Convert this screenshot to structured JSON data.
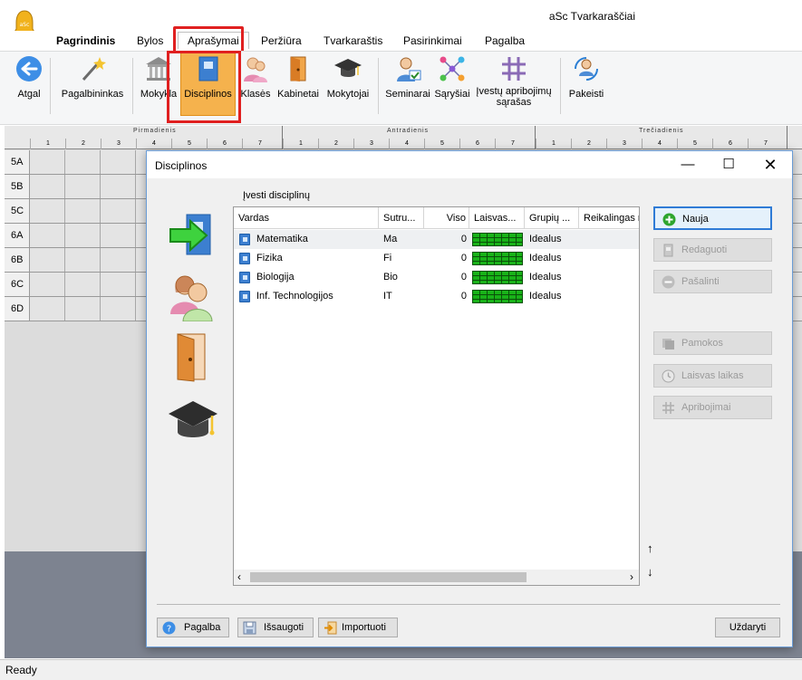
{
  "app": {
    "title": "aSc Tvarkaraščiai",
    "logo_text": "aSc"
  },
  "menu": {
    "tabs": [
      "Pagrindinis",
      "Bylos",
      "Aprašymai",
      "Peržiūra",
      "Tvarkaraštis",
      "Pasirinkimai",
      "Pagalba"
    ],
    "active": "Aprašymai"
  },
  "ribbon": {
    "atgal": "Atgal",
    "pagalbininkas": "Pagalbininkas",
    "mokykla": "Mokykla",
    "disciplinos": "Disciplinos",
    "klases": "Klasės",
    "kabinetai": "Kabinetai",
    "mokytojai": "Mokytojai",
    "seminarai": "Seminarai",
    "sarysiai": "Sąryšiai",
    "apribojimai_line1": "Įvestų apribojimų",
    "apribojimai_line2": "sąrašas",
    "pakeisti": "Pakeisti"
  },
  "grid": {
    "days": [
      "Pirmadienis",
      "Antradienis",
      "Trečiadienis"
    ],
    "periods": [
      "1",
      "2",
      "3",
      "4",
      "5",
      "6",
      "7"
    ],
    "rows": [
      "5A",
      "5B",
      "5C",
      "6A",
      "6B",
      "6C",
      "6D"
    ]
  },
  "status": {
    "text": "Ready"
  },
  "dialog": {
    "title": "Disciplinos",
    "list_caption": "Įvesti disciplinų",
    "columns": [
      "Vardas",
      "Sutru...",
      "Viso",
      "Laisvas...",
      "Grupių ...",
      "Reikalingas r"
    ],
    "rows": [
      {
        "name": "Matematika",
        "short": "Ma",
        "total": "0",
        "groups": "Idealus"
      },
      {
        "name": "Fizika",
        "short": "Fi",
        "total": "0",
        "groups": "Idealus"
      },
      {
        "name": "Biologija",
        "short": "Bio",
        "total": "0",
        "groups": "Idealus"
      },
      {
        "name": "Inf. Technologijos",
        "short": "IT",
        "total": "0",
        "groups": "Idealus"
      }
    ],
    "buttons": {
      "nauja": "Nauja",
      "redaguoti": "Redaguoti",
      "pasalinti": "Pašalinti",
      "pamokos": "Pamokos",
      "laisvas_laikas": "Laisvas laikas",
      "apribojimai": "Apribojimai"
    },
    "bottom": {
      "pagalba": "Pagalba",
      "issaugoti": "Išsaugoti",
      "importuoti": "Importuoti",
      "uzdaryti": "Uždaryti"
    },
    "arrow_up": "↑",
    "arrow_down": "↓"
  },
  "colors": {
    "accent": "#2f7bd6",
    "highlight": "#e02020",
    "ribbon_active": "#f5b24d",
    "free_time": "#18b218"
  }
}
